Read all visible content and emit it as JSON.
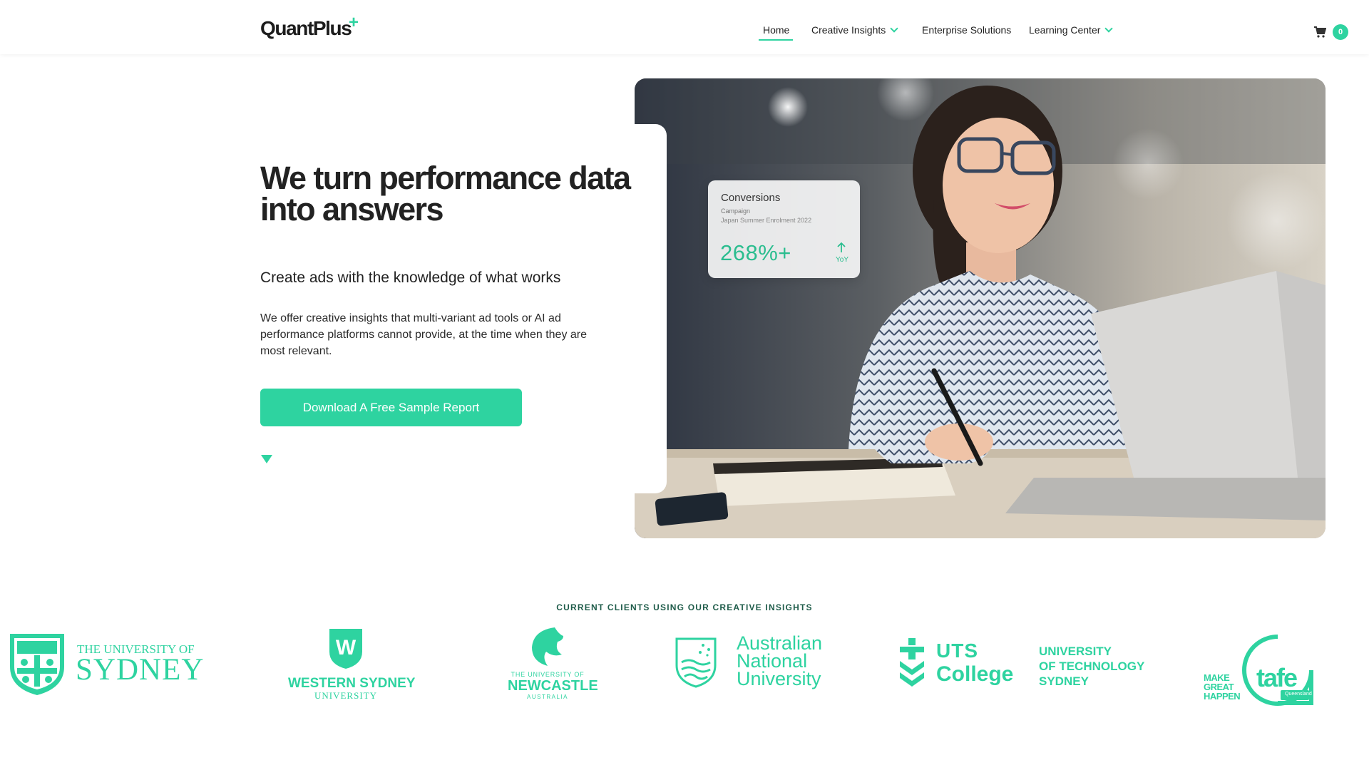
{
  "brand": {
    "name": "QuantPlus",
    "accent": "#2ed3a0"
  },
  "nav": {
    "items": [
      {
        "label": "Home",
        "active": true
      },
      {
        "label": "Creative Insights",
        "dropdown": true
      },
      {
        "label": "Enterprise Solutions",
        "dropdown": false
      },
      {
        "label": "Learning Center",
        "dropdown": true
      }
    ],
    "cart_count": "0"
  },
  "hero": {
    "title": "We turn performance data into answers",
    "subtitle": "Create ads with the knowledge of what works",
    "body": "We offer creative insights that multi-variant ad tools or AI ad performance platforms cannot provide, at the time when they are most relevant.",
    "cta_label": "Download A Free Sample Report"
  },
  "stat_card": {
    "title": "Conversions",
    "label": "Campaign",
    "campaign": "Japan Summer Enrolment 2022",
    "value": "268%+",
    "period": "YoY"
  },
  "clients": {
    "title": "CURRENT CLIENTS USING OUR CREATIVE INSIGHTS",
    "logos": [
      {
        "lines": [
          "THE UNIVERSITY OF",
          "SYDNEY"
        ]
      },
      {
        "lines": [
          "WESTERN SYDNEY",
          "UNIVERSITY"
        ]
      },
      {
        "lines": [
          "THE UNIVERSITY OF",
          "NEWCASTLE",
          "AUSTRALIA"
        ]
      },
      {
        "lines": [
          "Australian",
          "National",
          "University"
        ]
      },
      {
        "lines": [
          "UTS",
          "College"
        ]
      },
      {
        "lines": [
          "UNIVERSITY",
          "OF TECHNOLOGY",
          "SYDNEY"
        ]
      },
      {
        "lines": [
          "MAKE",
          "GREAT",
          "HAPPEN",
          "tafe",
          "Queensland"
        ]
      }
    ]
  }
}
